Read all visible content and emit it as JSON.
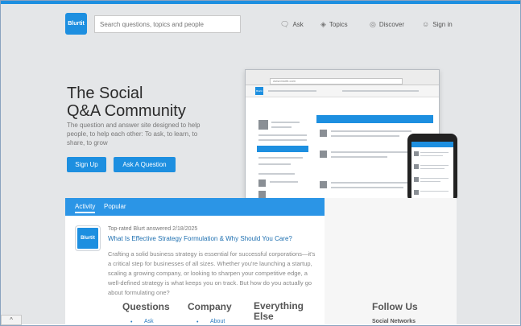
{
  "header": {
    "logo_text": "Blurtit",
    "search_placeholder": "Search questions, topics and people",
    "nav": {
      "ask": "Ask",
      "topics": "Topics",
      "discover": "Discover",
      "signin": "Sign in"
    }
  },
  "hero": {
    "title_line1": "The Social",
    "title_line2": "Q&A Community",
    "subtitle": "The question and answer site designed to help people, to help each other: To ask, to learn, to share, to grow",
    "signup_label": "Sign Up",
    "ask_label": "Ask A Question"
  },
  "mockup": {
    "url": "www.blurtit.com",
    "logo_text": "Blurtit"
  },
  "activity": {
    "tabs": [
      "Activity",
      "Popular"
    ],
    "logo_text": "Blurtit",
    "meta": "Top-rated Blurt answered 2/18/2025",
    "question": "What Is Effective Strategy Formulation & Why Should You Care?",
    "excerpt": "Crafting a solid business strategy is essential for successful corporations—it's a critical step for businesses of all sizes. Whether you're launching a startup, scaling a growing company, or looking to sharpen your competitive edge, a well-defined strategy is what keeps you on track. But how do you actually go about formulating one?"
  },
  "footer": {
    "questions": {
      "heading": "Questions",
      "link": "Ask"
    },
    "company": {
      "heading": "Company",
      "link": "About"
    },
    "everything": {
      "heading_line1": "Everything",
      "heading_line2": "Else"
    },
    "follow": {
      "heading": "Follow Us",
      "link": "Social Networks"
    }
  },
  "colors": {
    "brand": "#1d8fe0",
    "hero_bg": "#e4e6e8"
  },
  "corner_icon": "chevron-up-icon"
}
